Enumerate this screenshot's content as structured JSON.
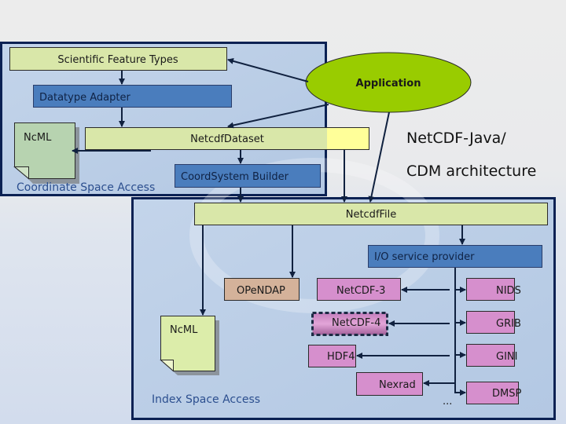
{
  "title": {
    "line1": "NetCDF-Java/",
    "line2": "CDM architecture"
  },
  "colors": {
    "region_border": "#0b2153",
    "region_fill": "#bcd0e8",
    "green_box": "#d9e7a9",
    "blue_box": "#4a7dbd",
    "yellow_box": "#ffff99",
    "ncml_top": "#b7d3b0",
    "ncml_bottom": "#dcedaa",
    "application": "#99cc00",
    "opendap": "#d4b29a",
    "iosp": "#d68fcd",
    "connector": "#10213f"
  },
  "regions": {
    "coordinate_space": {
      "caption": "Coordinate Space Access"
    },
    "index_space": {
      "caption": "Index Space Access"
    }
  },
  "nodes": {
    "scientific_feature_types": "Scientific Feature Types",
    "datatype_adapter": "Datatype Adapter",
    "ncml_top": "NcML",
    "netcdf_dataset": "NetcdfDataset",
    "coord_system_builder": "CoordSystem Builder",
    "application": "Application",
    "netcdf_file": "NetcdfFile",
    "io_service_provider": "I/O service provider",
    "opendap": "OPeNDAP",
    "ncml_bottom": "NcML",
    "ellipsis": "..."
  },
  "iosp_left": [
    "NetCDF-3",
    "NetCDF-4",
    "HDF4",
    "Nexrad"
  ],
  "iosp_right": [
    "NIDS",
    "GRIB",
    "GINI",
    "DMSP"
  ]
}
